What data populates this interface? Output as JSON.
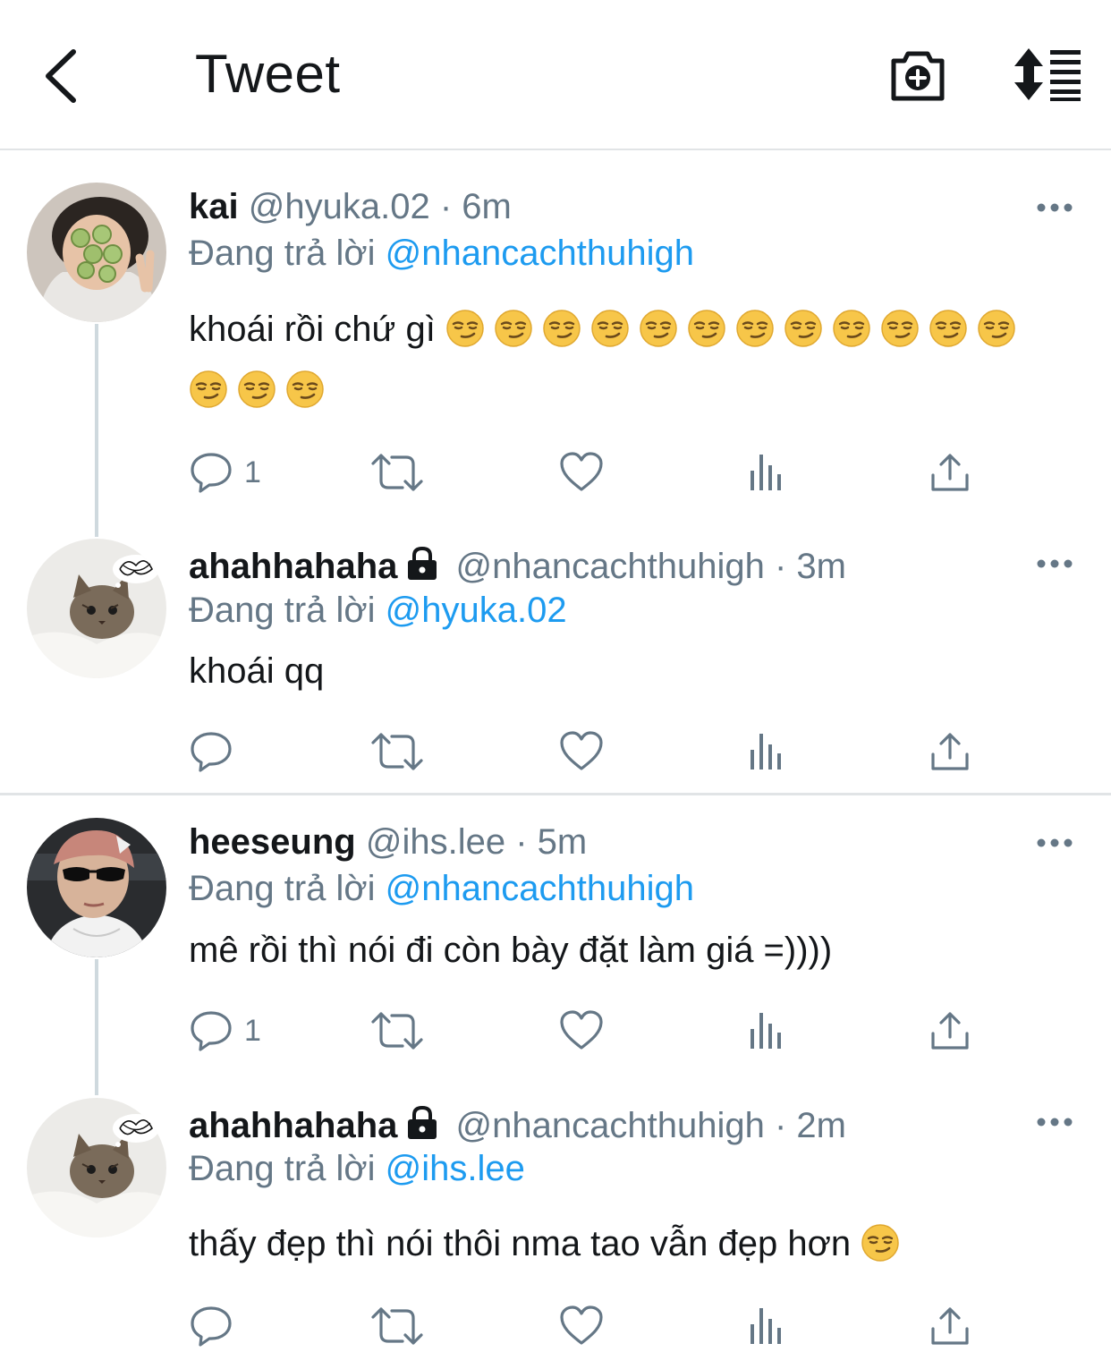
{
  "header": {
    "title": "Tweet",
    "back_icon": "chevron-left-icon",
    "camera_icon": "camera-plus-icon",
    "sort_icon": "sort-icon"
  },
  "colors": {
    "text": "#14171a",
    "secondary": "#657786",
    "link": "#1d9bf0",
    "divider": "#e1e4e6"
  },
  "tweets": [
    {
      "name": "kai",
      "handle": "@hyuka.02",
      "dot": "·",
      "time": "6m",
      "locked": false,
      "reply_prefix": "Đang trả lời",
      "reply_to": "@nhancachthuhigh",
      "text": "khoái rồi chứ gì",
      "emoji": "smirking-face",
      "emoji_count": 15,
      "reply_count": "1"
    },
    {
      "name": "ahahhahaha",
      "handle": "@nhancachthuhigh",
      "dot": "·",
      "time": "3m",
      "locked": true,
      "reply_prefix": "Đang trả lời",
      "reply_to": "@hyuka.02",
      "text": "khoái qq",
      "reply_count": ""
    },
    {
      "name": "heeseung",
      "handle": "@ihs.lee",
      "dot": "·",
      "time": "5m",
      "locked": false,
      "reply_prefix": "Đang trả lời",
      "reply_to": "@nhancachthuhigh",
      "text": "mê rồi thì nói đi còn bày đặt làm giá =))))",
      "reply_count": "1"
    },
    {
      "name": "ahahhahaha",
      "handle": "@nhancachthuhigh",
      "dot": "·",
      "time": "2m",
      "locked": true,
      "reply_prefix": "Đang trả lời",
      "reply_to": "@ihs.lee",
      "text": "thấy đẹp thì nói thôi nma tao vẫn đẹp hơn",
      "emoji": "smirking-face",
      "emoji_count": 1,
      "reply_count": ""
    }
  ]
}
